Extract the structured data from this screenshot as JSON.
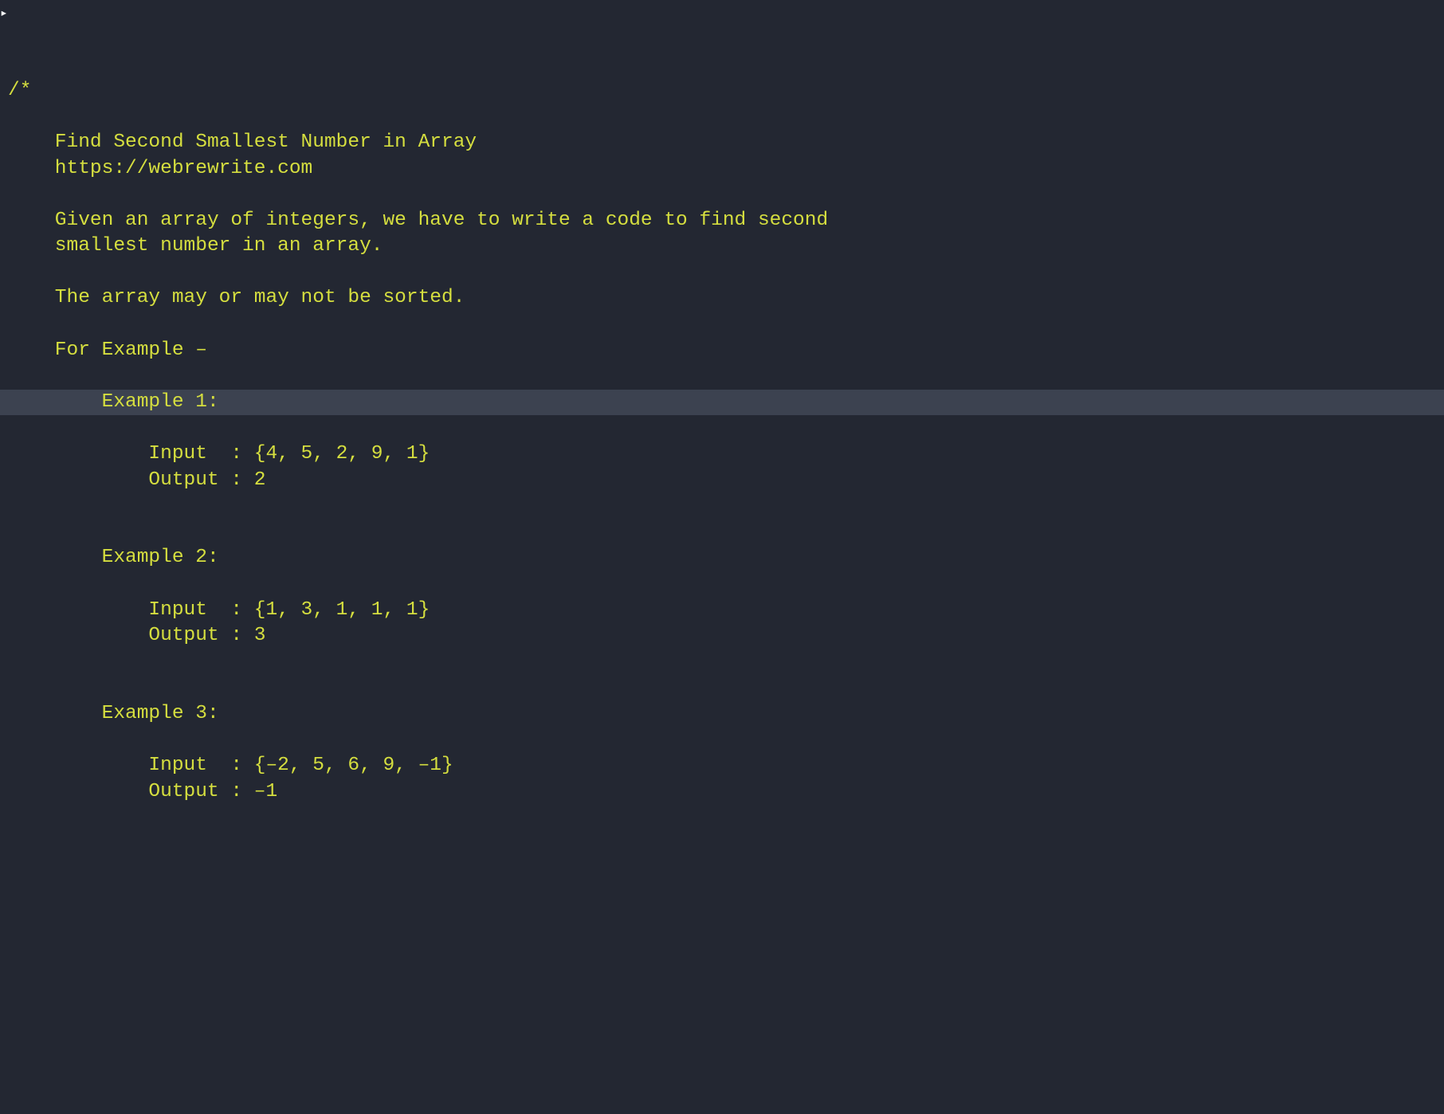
{
  "code": {
    "lines": [
      "/*",
      "",
      "    Find Second Smallest Number in Array",
      "    https://webrewrite.com",
      "",
      "    Given an array of integers, we have to write a code to find second",
      "    smallest number in an array.",
      "",
      "    The array may or may not be sorted.",
      "",
      "    For Example –",
      "",
      "        Example 1:",
      "",
      "            Input  : {4, 5, 2, 9, 1}",
      "            Output : 2",
      "",
      "",
      "        Example 2:",
      "",
      "            Input  : {1, 3, 1, 1, 1}",
      "            Output : 3",
      "",
      "",
      "        Example 3:",
      "",
      "            Input  : {–2, 5, 6, 9, –1}",
      "            Output : –1"
    ],
    "highlighted_line_index": 12
  },
  "colors": {
    "background": "#232732",
    "comment": "#d5de3f",
    "highlight": "#3c4250"
  }
}
